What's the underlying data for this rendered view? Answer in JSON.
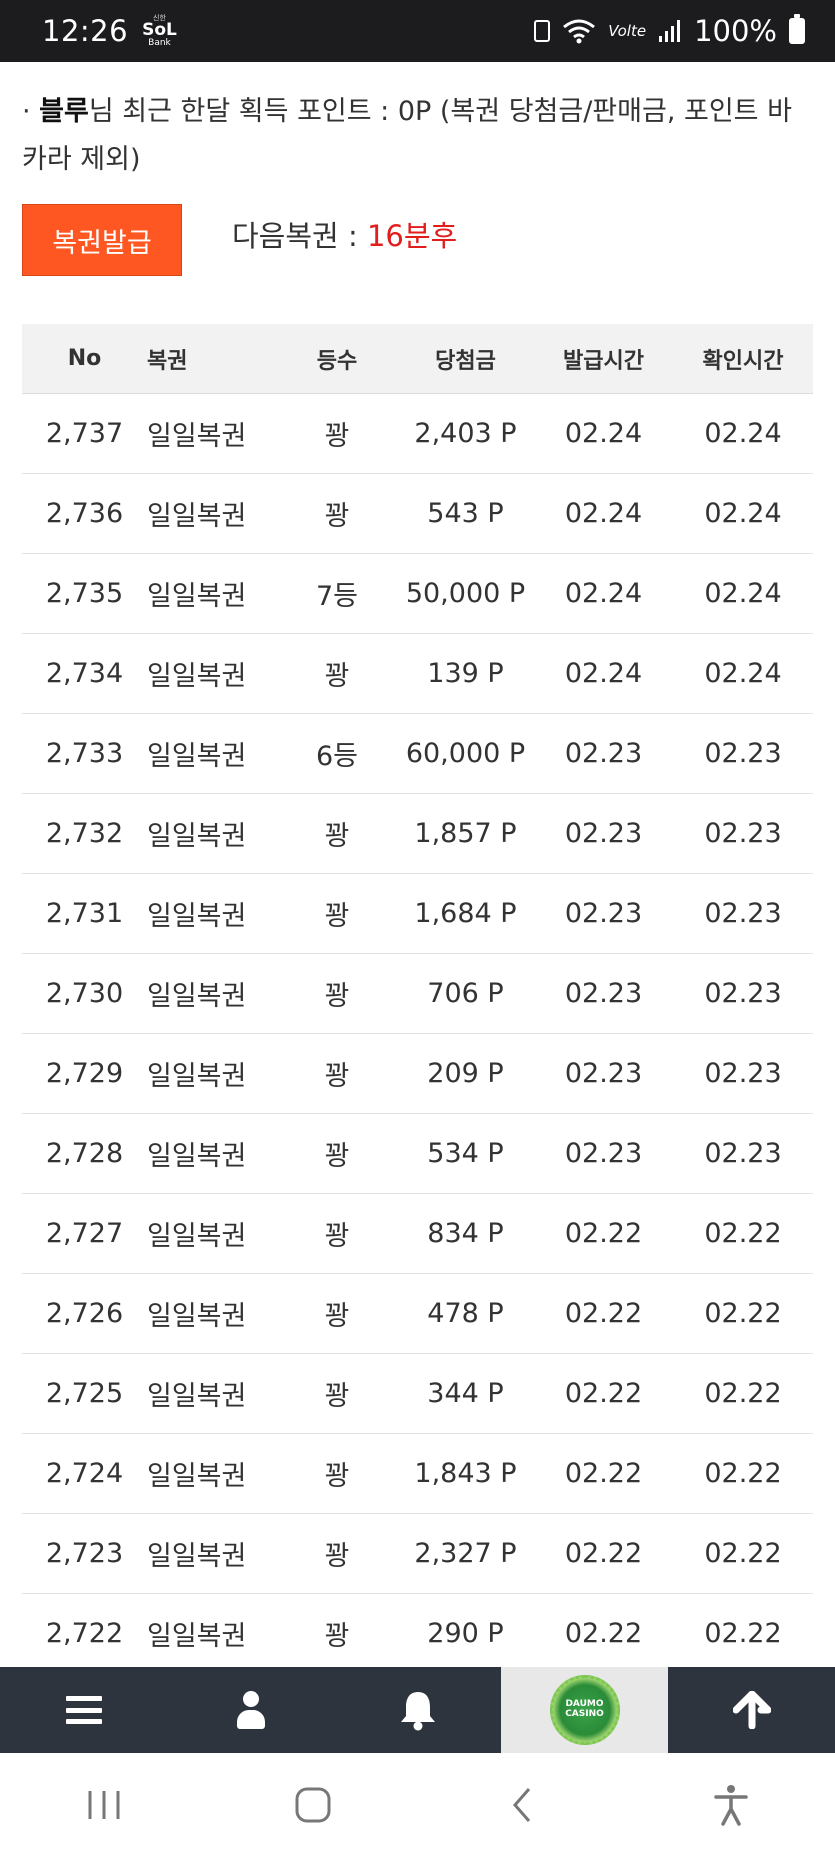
{
  "status_bar": {
    "time": "12:26",
    "bank_logo_top": "신한",
    "bank_logo_main": "SoL",
    "bank_logo_bottom": "Bank",
    "volte": "Volte",
    "battery": "100%"
  },
  "info": {
    "prefix": "· ",
    "username": "블루",
    "text": "님 최근 한달 획득 포인트 : 0P (복권 당첨금/판매금, 포인트 바카라 제외)"
  },
  "issue_button_label": "복권발급",
  "next_lottery": {
    "label": "다음복권 : ",
    "value": "16분후",
    "value_color": "#e01e1e"
  },
  "table": {
    "headers": {
      "no": "No",
      "name": "복권",
      "rank": "등수",
      "prize": "당첨금",
      "issued": "발급시간",
      "checked": "확인시간"
    },
    "rows": [
      {
        "no": "2,737",
        "name": "일일복권",
        "rank": "꽝",
        "prize": "2,403 P",
        "issued": "02.24",
        "checked": "02.24"
      },
      {
        "no": "2,736",
        "name": "일일복권",
        "rank": "꽝",
        "prize": "543 P",
        "issued": "02.24",
        "checked": "02.24"
      },
      {
        "no": "2,735",
        "name": "일일복권",
        "rank": "7등",
        "prize": "50,000 P",
        "issued": "02.24",
        "checked": "02.24"
      },
      {
        "no": "2,734",
        "name": "일일복권",
        "rank": "꽝",
        "prize": "139 P",
        "issued": "02.24",
        "checked": "02.24"
      },
      {
        "no": "2,733",
        "name": "일일복권",
        "rank": "6등",
        "prize": "60,000 P",
        "issued": "02.23",
        "checked": "02.23"
      },
      {
        "no": "2,732",
        "name": "일일복권",
        "rank": "꽝",
        "prize": "1,857 P",
        "issued": "02.23",
        "checked": "02.23"
      },
      {
        "no": "2,731",
        "name": "일일복권",
        "rank": "꽝",
        "prize": "1,684 P",
        "issued": "02.23",
        "checked": "02.23"
      },
      {
        "no": "2,730",
        "name": "일일복권",
        "rank": "꽝",
        "prize": "706 P",
        "issued": "02.23",
        "checked": "02.23"
      },
      {
        "no": "2,729",
        "name": "일일복권",
        "rank": "꽝",
        "prize": "209 P",
        "issued": "02.23",
        "checked": "02.23"
      },
      {
        "no": "2,728",
        "name": "일일복권",
        "rank": "꽝",
        "prize": "534 P",
        "issued": "02.23",
        "checked": "02.23"
      },
      {
        "no": "2,727",
        "name": "일일복권",
        "rank": "꽝",
        "prize": "834 P",
        "issued": "02.22",
        "checked": "02.22"
      },
      {
        "no": "2,726",
        "name": "일일복권",
        "rank": "꽝",
        "prize": "478 P",
        "issued": "02.22",
        "checked": "02.22"
      },
      {
        "no": "2,725",
        "name": "일일복권",
        "rank": "꽝",
        "prize": "344 P",
        "issued": "02.22",
        "checked": "02.22"
      },
      {
        "no": "2,724",
        "name": "일일복권",
        "rank": "꽝",
        "prize": "1,843 P",
        "issued": "02.22",
        "checked": "02.22"
      },
      {
        "no": "2,723",
        "name": "일일복권",
        "rank": "꽝",
        "prize": "2,327 P",
        "issued": "02.22",
        "checked": "02.22"
      },
      {
        "no": "2,722",
        "name": "일일복권",
        "rank": "꽝",
        "prize": "290 P",
        "issued": "02.22",
        "checked": "02.22"
      }
    ]
  },
  "bottom_nav": {
    "items": [
      "menu-icon",
      "user-icon",
      "bell-icon",
      "daumo-casino-logo",
      "arrow-up-icon"
    ],
    "logo_text_top": "DAUMO",
    "logo_text_bottom": "CASINO",
    "bar_color": "#2e343d",
    "active_bg": "#e8e8e8"
  },
  "system_nav": {
    "items": [
      "recent-apps-icon",
      "home-icon",
      "back-icon",
      "accessibility-icon"
    ]
  },
  "colors": {
    "accent_button": "#ff5722",
    "highlight_text": "#e01e1e"
  }
}
